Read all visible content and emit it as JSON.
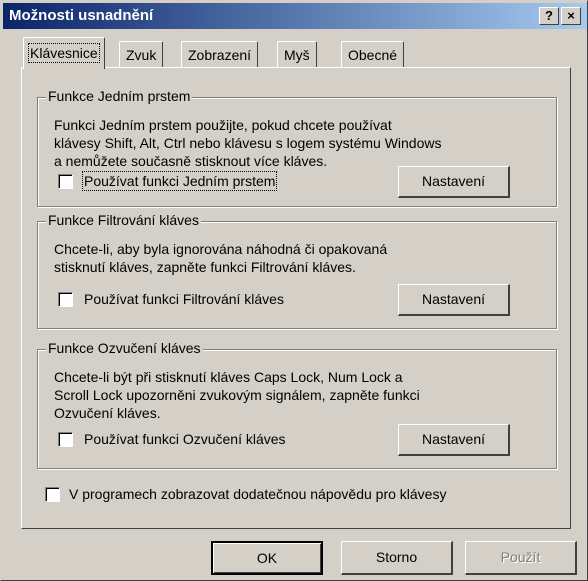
{
  "window": {
    "title": "Možnosti usnadnění",
    "help_glyph": "?",
    "close_glyph": "×"
  },
  "tabs": [
    {
      "label": "Klávesnice",
      "active": true
    },
    {
      "label": "Zvuk"
    },
    {
      "label": "Zobrazení"
    },
    {
      "label": "Myš"
    },
    {
      "label": "Obecné"
    }
  ],
  "groups": [
    {
      "title": "Funkce Jedním prstem",
      "desc_lines": [
        "Funkci Jedním prstem použijte, pokud chcete používat",
        "klávesy Shift, Alt, Ctrl nebo klávesu s logem systému Windows",
        "a nemůžete současně stisknout více kláves."
      ],
      "checkbox_label": "Používat funkci Jedním prstem",
      "checked": false,
      "button_label": "Nastavení"
    },
    {
      "title": "Funkce Filtrování kláves",
      "desc_lines": [
        "Chcete-li, aby byla ignorována náhodná či opakovaná",
        "stisknutí kláves, zapněte funkci Filtrování kláves."
      ],
      "checkbox_label": "Používat funkci Filtrování kláves",
      "checked": false,
      "button_label": "Nastavení"
    },
    {
      "title": "Funkce Ozvučení kláves",
      "desc_lines": [
        "Chcete-li být při stisknutí kláves Caps Lock, Num Lock a",
        "Scroll Lock upozorněni zvukovým signálem, zapněte funkci",
        "Ozvučení kláves."
      ],
      "checkbox_label": "Používat funkci Ozvučení kláves",
      "checked": false,
      "button_label": "Nastavení"
    }
  ],
  "extra_help_checkbox": {
    "label": "V programech zobrazovat dodatečnou nápovědu pro klávesy",
    "checked": false
  },
  "buttons": {
    "ok": "OK",
    "cancel": "Storno",
    "apply": "Použít"
  }
}
